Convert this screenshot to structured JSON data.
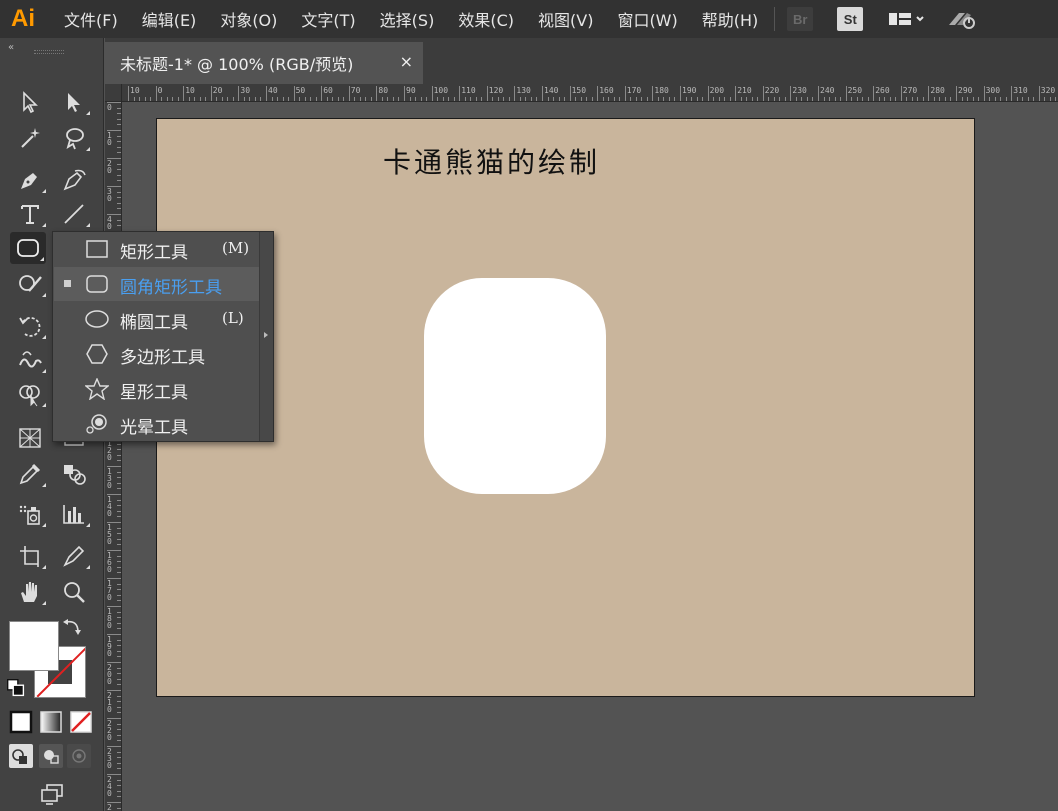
{
  "app": {
    "logo": "Ai",
    "menu": [
      "文件(F)",
      "编辑(E)",
      "对象(O)",
      "文字(T)",
      "选择(S)",
      "效果(C)",
      "视图(V)",
      "窗口(W)",
      "帮助(H)"
    ],
    "bridge_badge": "Br",
    "stock_badge": "St"
  },
  "document": {
    "tab_label": "未标题-1* @ 100% (RGB/预览)",
    "close_glyph": "×"
  },
  "artboard": {
    "title": "卡通熊猫的绘制",
    "background_color": "#c9b59c",
    "shape_color": "#ffffff"
  },
  "ruler": {
    "horizontal_labels": [
      "10",
      "0",
      "10",
      "20",
      "30",
      "40",
      "50",
      "60",
      "70",
      "80",
      "90",
      "100",
      "110",
      "120",
      "130",
      "140",
      "150",
      "160",
      "170",
      "180",
      "190",
      "200",
      "210",
      "220",
      "230",
      "240",
      "250",
      "260",
      "270",
      "280",
      "290",
      "300",
      "310",
      "320"
    ],
    "vertical_labels": [
      "0",
      "1 0",
      "2 0",
      "3 0",
      "4 0",
      "5 0",
      "6 0",
      "7 0",
      "8 0",
      "9 0",
      "1 0 0",
      "1 1 0",
      "1 2 0",
      "1 3 0",
      "1 4 0",
      "1 5 0",
      "1 6 0",
      "1 7 0",
      "1 8 0",
      "1 9 0",
      "2 0 0",
      "2 1 0",
      "2 2 0",
      "2 3 0",
      "2 4 0",
      "2 5 0"
    ]
  },
  "flyout": {
    "items": [
      {
        "label": "矩形工具",
        "shortcut": "(M)",
        "icon": "rectangle-icon",
        "selected": false
      },
      {
        "label": "圆角矩形工具",
        "shortcut": "",
        "icon": "rounded-rectangle-icon",
        "selected": true
      },
      {
        "label": "椭圆工具",
        "shortcut": "(L)",
        "icon": "ellipse-icon",
        "selected": false
      },
      {
        "label": "多边形工具",
        "shortcut": "",
        "icon": "polygon-icon",
        "selected": false
      },
      {
        "label": "星形工具",
        "shortcut": "",
        "icon": "star-icon",
        "selected": false
      },
      {
        "label": "光晕工具",
        "shortcut": "",
        "icon": "flare-icon",
        "selected": false
      }
    ]
  },
  "colors": {
    "accent_selected": "#4a9ff0",
    "logo": "#ff9a00",
    "stroke_none": "#e02020"
  }
}
